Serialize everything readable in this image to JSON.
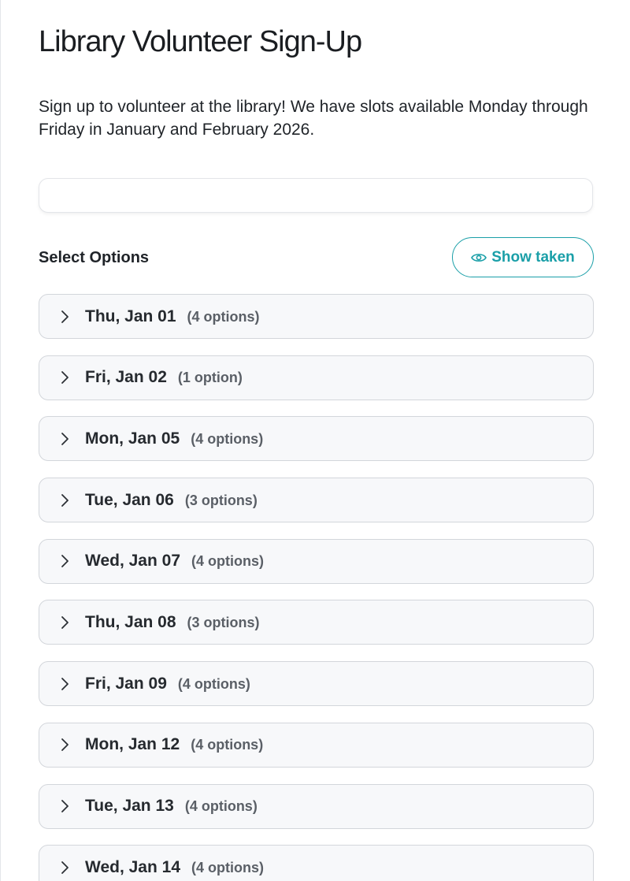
{
  "page": {
    "title": "Library Volunteer Sign-Up",
    "description": "Sign up to volunteer at the library! We have slots available Monday through Friday in January and February 2026."
  },
  "search": {
    "value": "",
    "placeholder": ""
  },
  "options_section": {
    "title": "Select Options",
    "show_taken_label": "Show taken",
    "show_taken_icon": "eye-icon",
    "accent_color": "#1a9fa8"
  },
  "dates": [
    {
      "label": "Thu, Jan 01",
      "count": "(4 options)"
    },
    {
      "label": "Fri, Jan 02",
      "count": "(1 option)"
    },
    {
      "label": "Mon, Jan 05",
      "count": "(4 options)"
    },
    {
      "label": "Tue, Jan 06",
      "count": "(3 options)"
    },
    {
      "label": "Wed, Jan 07",
      "count": "(4 options)"
    },
    {
      "label": "Thu, Jan 08",
      "count": "(3 options)"
    },
    {
      "label": "Fri, Jan 09",
      "count": "(4 options)"
    },
    {
      "label": "Mon, Jan 12",
      "count": "(4 options)"
    },
    {
      "label": "Tue, Jan 13",
      "count": "(4 options)"
    },
    {
      "label": "Wed, Jan 14",
      "count": "(4 options)"
    }
  ],
  "row_icon": "chevron-right-icon"
}
